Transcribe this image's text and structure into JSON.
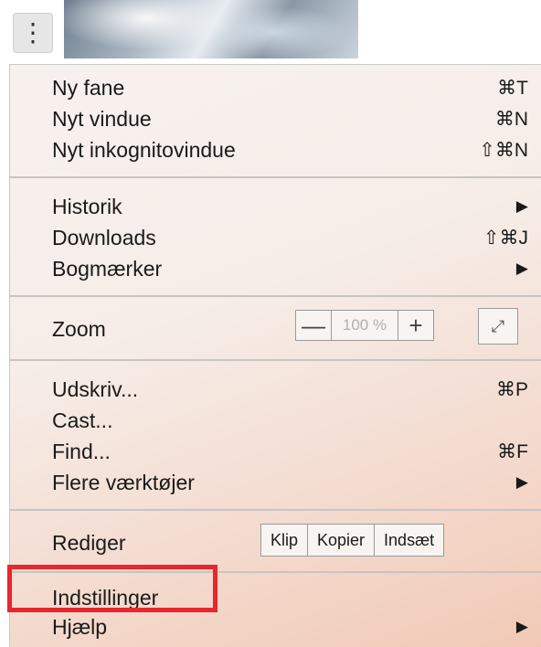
{
  "menu": {
    "group1": [
      {
        "label": "Ny fane",
        "shortcut": "⌘T"
      },
      {
        "label": "Nyt vindue",
        "shortcut": "⌘N"
      },
      {
        "label": "Nyt inkognitovindue",
        "shortcut": "⇧⌘N"
      }
    ],
    "group2": [
      {
        "label": "Historik",
        "submenu": "▶"
      },
      {
        "label": "Downloads",
        "shortcut": "⇧⌘J"
      },
      {
        "label": "Bogmærker",
        "submenu": "▶"
      }
    ],
    "zoom": {
      "label": "Zoom",
      "minus": "—",
      "value": "100 %",
      "plus": "+",
      "fullscreen_icon": "fullscreen-icon"
    },
    "group4": [
      {
        "label": "Udskriv...",
        "shortcut": "⌘P"
      },
      {
        "label": "Cast...",
        "shortcut": ""
      },
      {
        "label": "Find...",
        "shortcut": "⌘F"
      },
      {
        "label": "Flere værktøjer",
        "submenu": "▶"
      }
    ],
    "edit": {
      "label": "Rediger",
      "cut": "Klip",
      "copy": "Kopier",
      "paste": "Indsæt"
    },
    "group6": [
      {
        "label": "Indstillinger"
      },
      {
        "label": "Hjælp",
        "submenu": "▶"
      }
    ]
  },
  "icons": {
    "menu_button": "vertical-dots-icon",
    "fullscreen": "⤢"
  },
  "colors": {
    "highlight": "#e8262d"
  }
}
